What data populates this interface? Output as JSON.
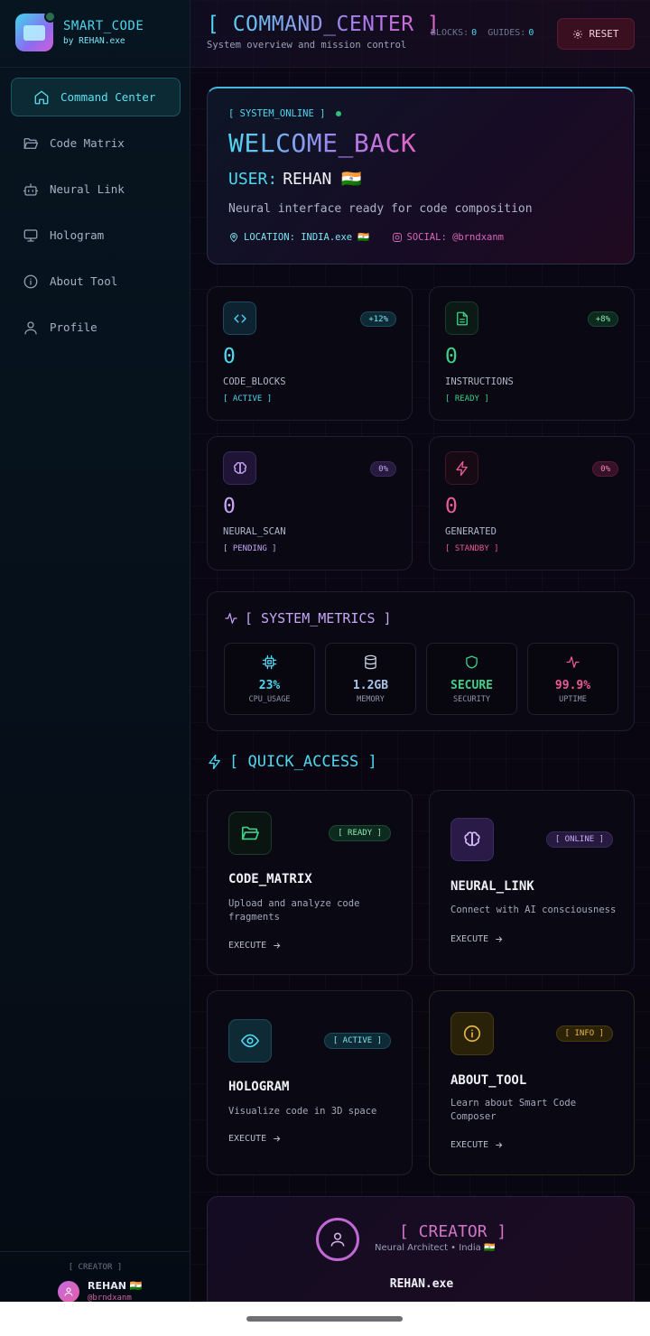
{
  "brand": {
    "title": "SMART_CODE",
    "subtitle": "by REHAN.exe"
  },
  "sidebar": {
    "items": [
      {
        "label": "Command Center",
        "icon": "home-icon",
        "active": true
      },
      {
        "label": "Code Matrix",
        "icon": "folder-open-icon"
      },
      {
        "label": "Neural Link",
        "icon": "bot-icon"
      },
      {
        "label": "Hologram",
        "icon": "monitor-icon"
      },
      {
        "label": "About Tool",
        "icon": "info-icon"
      },
      {
        "label": "Profile",
        "icon": "user-icon"
      }
    ],
    "footer": {
      "label": "[ CREATOR ]",
      "name": "REHAN 🇮🇳",
      "handle": "@brndxanm"
    }
  },
  "header": {
    "title": "[ COMMAND_CENTER ]",
    "subtitle": "System overview and mission control",
    "blocks_label": "BLOCKS:",
    "blocks_value": "0",
    "guides_label": "GUIDES:",
    "guides_value": "0",
    "reset_label": "RESET"
  },
  "welcome": {
    "status": "[ SYSTEM_ONLINE ]",
    "title": "WELCOME_BACK",
    "user_label": "USER:",
    "user_name": "REHAN 🇮🇳",
    "description": "Neural interface ready for code composition",
    "location": "LOCATION: INDIA.exe 🇮🇳",
    "social": "SOCIAL: @brndxanm"
  },
  "stats": [
    {
      "value": "0",
      "label": "CODE_BLOCKS",
      "status": "[ ACTIVE ]",
      "badge": "+12%",
      "icon": "code-icon",
      "color": "#4fd8f0"
    },
    {
      "value": "0",
      "label": "INSTRUCTIONS",
      "status": "[ READY ]",
      "badge": "+8%",
      "icon": "file-text-icon",
      "color": "#3fd08a"
    },
    {
      "value": "0",
      "label": "NEURAL_SCAN",
      "status": "[ PENDING ]",
      "badge": "0%",
      "icon": "brain-icon",
      "color": "#b48cf0"
    },
    {
      "value": "0",
      "label": "GENERATED",
      "status": "[ STANDBY ]",
      "badge": "0%",
      "icon": "zap-icon",
      "color": "#ec5a9a"
    }
  ],
  "metrics": {
    "title": "[ SYSTEM_METRICS ]",
    "items": [
      {
        "value": "23%",
        "label": "CPU_USAGE",
        "icon": "cpu-icon",
        "color": "#4fd8f0"
      },
      {
        "value": "1.2GB",
        "label": "MEMORY",
        "icon": "database-icon",
        "color": "#a9c6ea"
      },
      {
        "value": "SECURE",
        "label": "SECURITY",
        "icon": "shield-icon",
        "color": "#3fd08a"
      },
      {
        "value": "99.9%",
        "label": "UPTIME",
        "icon": "activity-icon",
        "color": "#ec5a9a"
      }
    ]
  },
  "quick_access": {
    "title": "[ QUICK_ACCESS ]",
    "execute_label": "EXECUTE",
    "cards": [
      {
        "title": "CODE_MATRIX",
        "description": "Upload and analyze code fragments",
        "tag": "[ READY ]",
        "icon": "folder-open-icon",
        "color": "#3fd08a"
      },
      {
        "title": "NEURAL_LINK",
        "description": "Connect with AI consciousness",
        "tag": "[ ONLINE ]",
        "icon": "brain-icon",
        "color": "#b48cf0"
      },
      {
        "title": "HOLOGRAM",
        "description": "Visualize code in 3D space",
        "tag": "[ ACTIVE ]",
        "icon": "eye-icon",
        "color": "#4fd8f0"
      },
      {
        "title": "ABOUT_TOOL",
        "description": "Learn about Smart Code Composer",
        "tag": "[ INFO ]",
        "icon": "info-icon",
        "color": "#e2b54a"
      }
    ]
  },
  "creator": {
    "title": "[ CREATOR ]",
    "subtitle": "Neural Architect • India 🇮🇳",
    "name": "REHAN.exe"
  }
}
